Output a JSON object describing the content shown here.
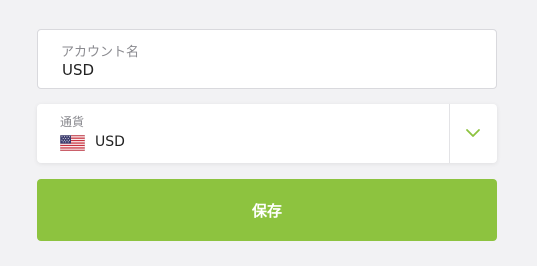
{
  "account_name": {
    "label": "アカウント名",
    "value": "USD"
  },
  "currency": {
    "label": "通貨",
    "value": "USD",
    "flag_icon": "us-flag-icon"
  },
  "save_button": {
    "label": "保存"
  },
  "colors": {
    "accent": "#8dc33f",
    "chevron": "#8dc33f",
    "background": "#f2f2f4"
  }
}
